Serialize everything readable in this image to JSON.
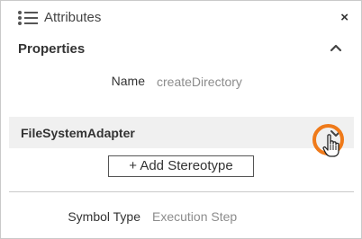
{
  "header": {
    "title": "Attributes",
    "icon": "list-icon",
    "close_glyph": "×"
  },
  "properties": {
    "section_title": "Properties",
    "collapse_icon": "chevron-up-icon",
    "name_label": "Name",
    "name_value": "createDirectory"
  },
  "stereotype": {
    "label": "FileSystemAdapter",
    "expand_icon": "chevron-down-icon",
    "add_button_label": "+ Add Stereotype"
  },
  "symbol_type": {
    "label": "Symbol Type",
    "value": "Execution Step"
  },
  "colors": {
    "highlight": "#ef7a1a",
    "row_background": "#f0f0f0",
    "value_text": "#8c8c8c"
  }
}
